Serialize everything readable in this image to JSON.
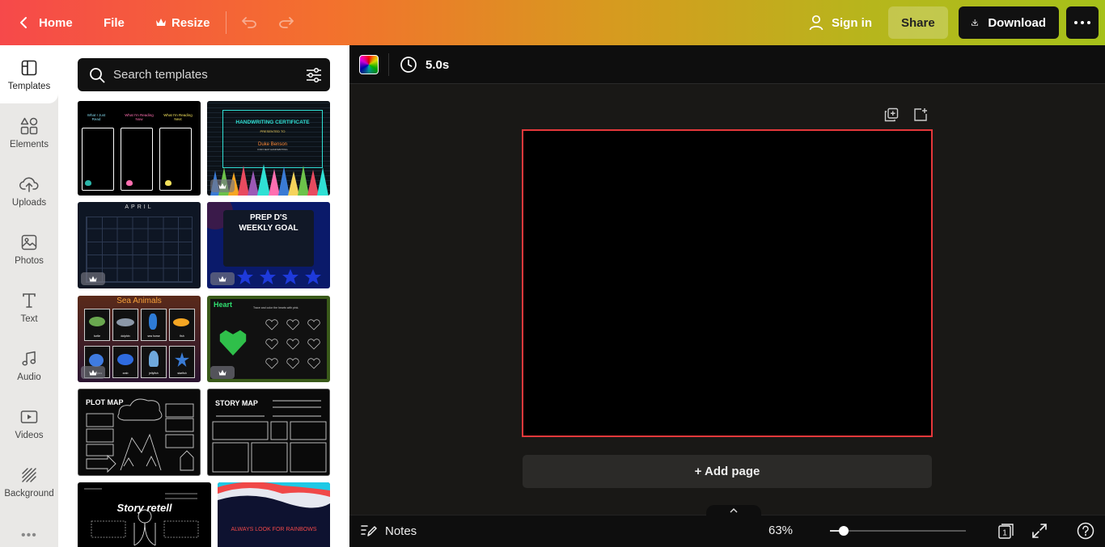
{
  "topbar": {
    "home_label": "Home",
    "file_label": "File",
    "resize_label": "Resize",
    "signin_label": "Sign in",
    "share_label": "Share",
    "download_label": "Download"
  },
  "rail": {
    "items": [
      {
        "label": "Templates",
        "icon": "templates-icon"
      },
      {
        "label": "Elements",
        "icon": "elements-icon"
      },
      {
        "label": "Uploads",
        "icon": "uploads-icon"
      },
      {
        "label": "Photos",
        "icon": "photos-icon"
      },
      {
        "label": "Text",
        "icon": "text-icon"
      },
      {
        "label": "Audio",
        "icon": "audio-icon"
      },
      {
        "label": "Videos",
        "icon": "videos-icon"
      },
      {
        "label": "Background",
        "icon": "background-icon"
      }
    ]
  },
  "search": {
    "placeholder": "Search templates"
  },
  "templates": {
    "t1": {
      "a": "What I Just Read",
      "b": "What I'm Reading Now",
      "c": "What I'm Reading Next"
    },
    "t2": {
      "title": "HANDWRITING CERTIFICATE",
      "sub": "PRESENTED TO",
      "name": "Duke Benson",
      "note": "FOR NEAT HANDWRITING"
    },
    "t3": {
      "title": "APRIL"
    },
    "t4": {
      "title": "PREP D'S",
      "sub": "WEEKLY GOAL"
    },
    "t5": {
      "title": "Sea Animals",
      "labels": [
        "turtle",
        "dolphin",
        "sea horse",
        "fish",
        "octopus",
        "crab",
        "jellyfish",
        "starfish"
      ]
    },
    "t6": {
      "title": "Heart",
      "sub": "Trace and color the hearts with pink."
    },
    "t7": {
      "title": "PLOT MAP"
    },
    "t8": {
      "title": "STORY MAP"
    },
    "t9": {
      "title": "Story retell"
    },
    "t10": {
      "title": "ALWAYS LOOK FOR RAINBOWS"
    }
  },
  "editor": {
    "duration": "5.0s",
    "add_page_label": "+ Add page",
    "canvas_color": "#000000",
    "selection_color": "#e5383b"
  },
  "footer": {
    "notes_label": "Notes",
    "zoom": "63%",
    "zoom_fraction": 0.1,
    "page_number": "1"
  }
}
